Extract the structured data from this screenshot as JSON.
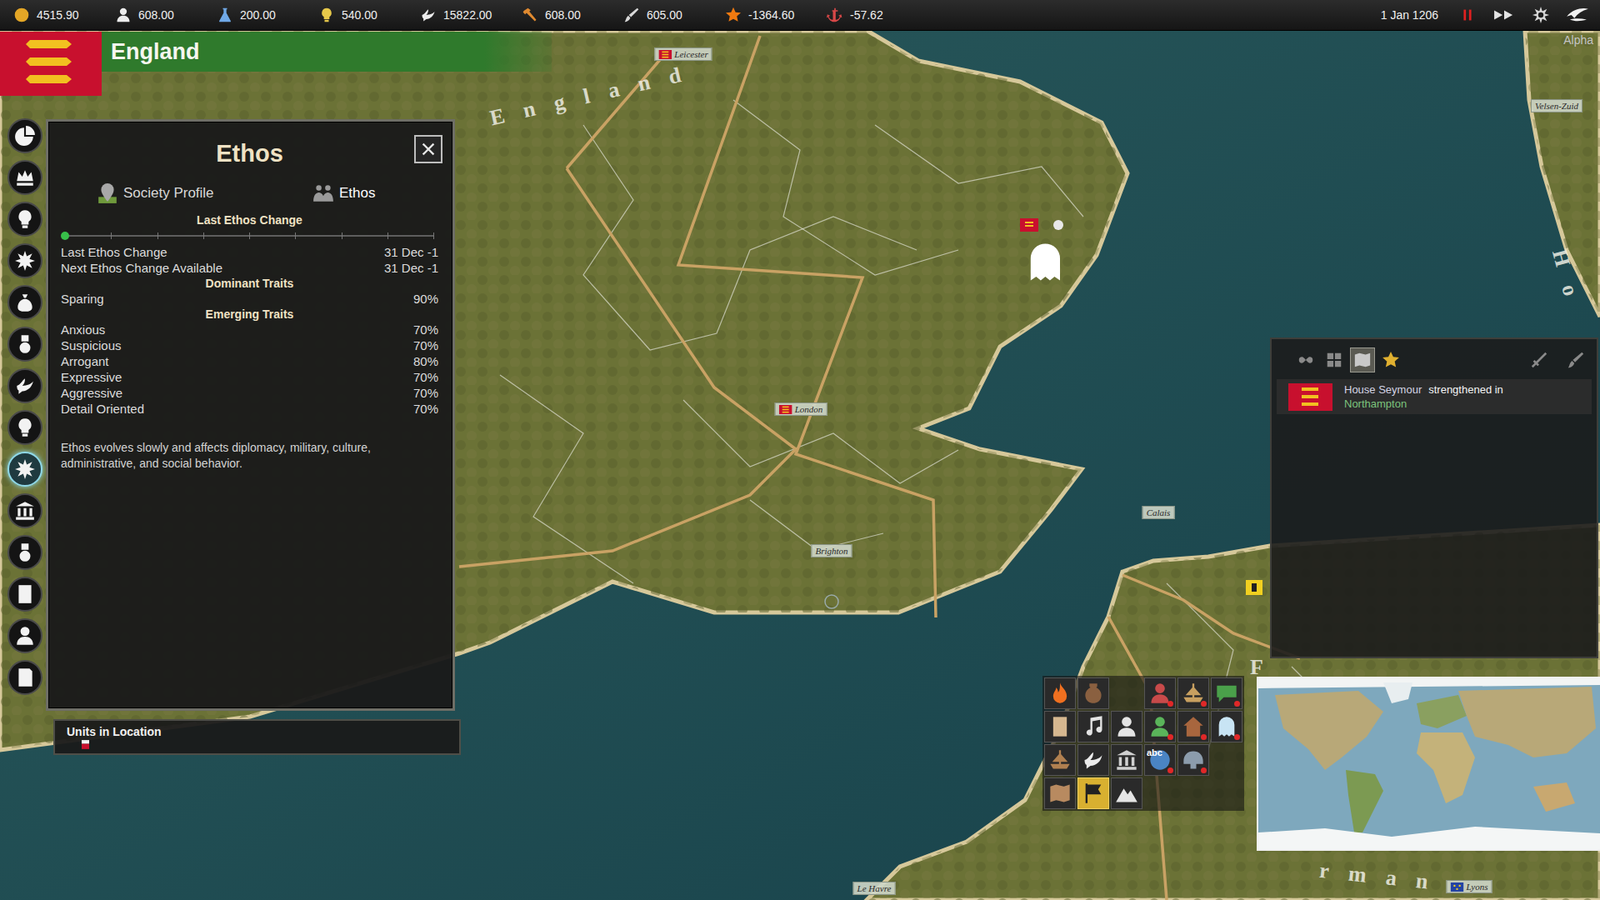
{
  "topbar": {
    "resources": [
      {
        "kind": "gold",
        "value": "4515.90"
      },
      {
        "kind": "manpower",
        "value": "608.00"
      },
      {
        "kind": "science",
        "value": "200.00"
      },
      {
        "kind": "ideas",
        "value": "540.00"
      },
      {
        "kind": "diplomacy",
        "value": "15822.00"
      },
      {
        "kind": "production",
        "value": "608.00"
      },
      {
        "kind": "culture",
        "value": "605.00"
      },
      {
        "kind": "prestige",
        "value": "-1364.60"
      },
      {
        "kind": "naval",
        "value": "-57.62"
      }
    ],
    "date": "1 Jan 1206",
    "paused": true
  },
  "nation": {
    "name": "England"
  },
  "sidebar": {
    "items": [
      {
        "kind": "pie",
        "selected": false
      },
      {
        "kind": "crown",
        "selected": false
      },
      {
        "kind": "bulb",
        "selected": false
      },
      {
        "kind": "burst",
        "selected": false
      },
      {
        "kind": "money",
        "selected": false
      },
      {
        "kind": "medal",
        "selected": false
      },
      {
        "kind": "dove",
        "selected": false
      },
      {
        "kind": "bulb",
        "selected": false
      },
      {
        "kind": "burst",
        "selected": true
      },
      {
        "kind": "building",
        "selected": false
      },
      {
        "kind": "medal",
        "selected": false
      },
      {
        "kind": "scroll",
        "selected": false
      },
      {
        "kind": "person",
        "selected": false
      },
      {
        "kind": "notebook",
        "selected": false
      }
    ]
  },
  "ethos_panel": {
    "title": "Ethos",
    "tabs": [
      {
        "label": "Society Profile",
        "kind": "map",
        "selected": false
      },
      {
        "label": "Ethos",
        "kind": "people",
        "selected": true
      }
    ],
    "slider_title": "Last Ethos Change",
    "slider": {
      "level": 0
    },
    "info_rows": [
      {
        "label": "Last Ethos Change",
        "value": "31 Dec -1"
      },
      {
        "label": "Next Ethos Change Available",
        "value": "31 Dec -1"
      }
    ],
    "dominant_title": "Dominant Traits",
    "dominant": [
      {
        "name": "Sparing",
        "value": "90%"
      }
    ],
    "emerging_title": "Emerging Traits",
    "emerging": [
      {
        "name": "Anxious",
        "value": "70%"
      },
      {
        "name": "Suspicious",
        "value": "70%"
      },
      {
        "name": "Arrogant",
        "value": "80%"
      },
      {
        "name": "Expressive",
        "value": "70%"
      },
      {
        "name": "Aggressive",
        "value": "70%"
      },
      {
        "name": "Detail Oriented",
        "value": "70%"
      }
    ],
    "description": "Ethos evolves slowly and affects diplomacy, military, culture, administrative, and social behavior."
  },
  "units_panel": {
    "title": "Units in Location"
  },
  "map": {
    "region_labels": [
      {
        "text": "England"
      },
      {
        "text": "Ho"
      },
      {
        "text": "F"
      },
      {
        "text": "rman"
      }
    ],
    "labels": [
      {
        "text": "Leicester",
        "kind": "england"
      },
      {
        "text": "London",
        "kind": "england"
      },
      {
        "text": "Brighton",
        "kind": "none"
      },
      {
        "text": "Calais",
        "kind": "none"
      },
      {
        "text": "Le Havre",
        "kind": "none"
      },
      {
        "text": "Lyons",
        "kind": "france"
      },
      {
        "text": "Velsen-Zuid",
        "kind": "none"
      }
    ],
    "watermark": "Alpha"
  },
  "events": {
    "filters": [
      {
        "kind": "infinity",
        "selected": false
      },
      {
        "kind": "grid",
        "selected": false
      },
      {
        "kind": "map",
        "selected": true
      },
      {
        "kind": "star5",
        "selected": false
      }
    ],
    "tools": [
      {
        "kind": "sword"
      },
      {
        "kind": "brush"
      }
    ],
    "items": [
      {
        "subject": "House Seymour",
        "text": "strengthened in",
        "place": "Northampton"
      }
    ]
  },
  "actions": {
    "rows": [
      [
        {
          "kind": "fire",
          "alert": false,
          "selected": false
        },
        {
          "kind": "pot",
          "alert": false,
          "selected": false
        },
        {
          "kind": "empty",
          "alert": false,
          "selected": false
        },
        {
          "kind": "knight",
          "alert": true,
          "selected": false
        },
        {
          "kind": "ship",
          "alert": true,
          "selected": false
        },
        {
          "kind": "speech",
          "alert": true,
          "selected": false
        }
      ],
      [
        {
          "kind": "scroll",
          "alert": false,
          "selected": false
        },
        {
          "kind": "note",
          "alert": false,
          "selected": false
        },
        {
          "kind": "person",
          "alert": false,
          "selected": false
        },
        {
          "kind": "courtier",
          "alert": true,
          "selected": false
        },
        {
          "kind": "house",
          "alert": true,
          "selected": false
        },
        {
          "kind": "ghost",
          "alert": true,
          "selected": false
        }
      ],
      [
        {
          "kind": "ship2",
          "alert": false,
          "selected": false
        },
        {
          "kind": "dove",
          "alert": false,
          "selected": false
        },
        {
          "kind": "building",
          "alert": false,
          "selected": false
        },
        {
          "kind": "globe",
          "alert": true,
          "selected": false,
          "label": "abc"
        },
        {
          "kind": "helmet",
          "alert": true,
          "selected": false
        }
      ],
      [
        {
          "kind": "map",
          "alert": false,
          "selected": false
        },
        {
          "kind": "flag",
          "alert": false,
          "selected": true
        },
        {
          "kind": "mountain",
          "alert": false,
          "selected": false
        }
      ]
    ]
  }
}
